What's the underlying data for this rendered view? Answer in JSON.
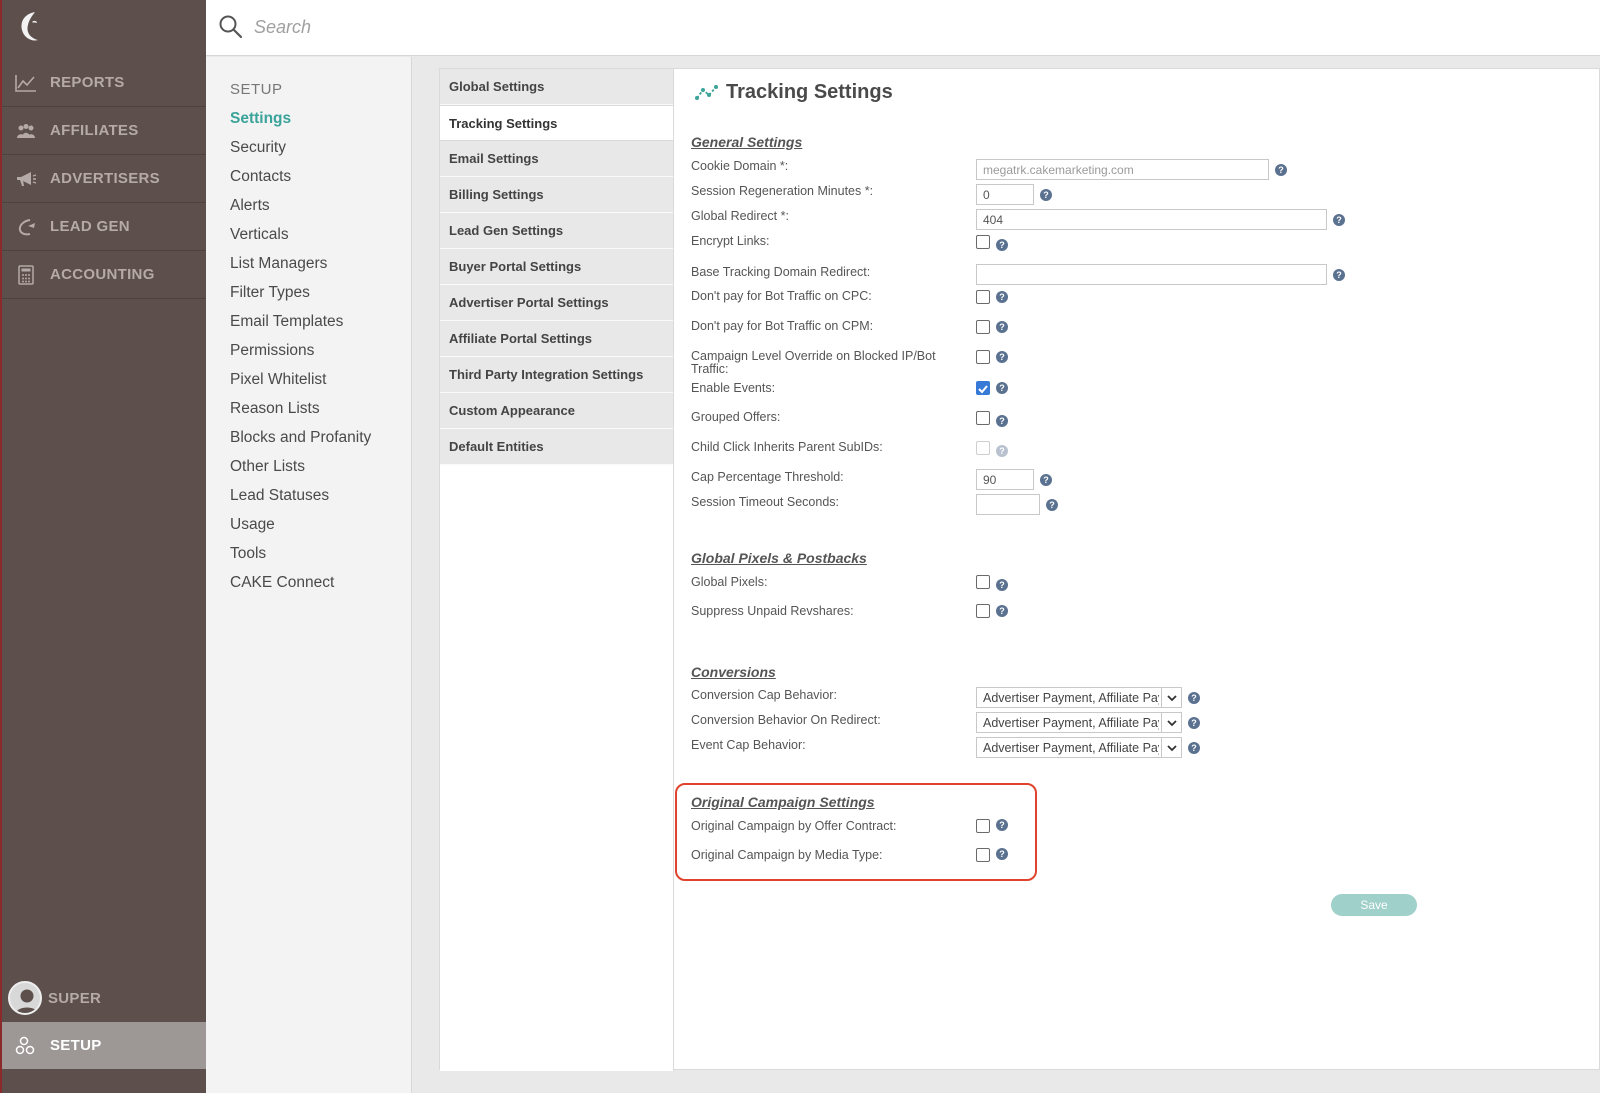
{
  "search": {
    "placeholder": "Search"
  },
  "nav": {
    "items": [
      {
        "label": "REPORTS"
      },
      {
        "label": "AFFILIATES"
      },
      {
        "label": "ADVERTISERS"
      },
      {
        "label": "LEAD GEN"
      },
      {
        "label": "ACCOUNTING"
      }
    ],
    "user_label": "SUPER",
    "setup_label": "SETUP"
  },
  "submenu": {
    "title": "SETUP",
    "items": [
      "Settings",
      "Security",
      "Contacts",
      "Alerts",
      "Verticals",
      "List Managers",
      "Filter Types",
      "Email Templates",
      "Permissions",
      "Pixel Whitelist",
      "Reason Lists",
      "Blocks and Profanity",
      "Other Lists",
      "Lead Statuses",
      "Usage",
      "Tools",
      "CAKE Connect"
    ]
  },
  "tabs": [
    "Global Settings",
    "Tracking Settings",
    "Email Settings",
    "Billing Settings",
    "Lead Gen Settings",
    "Buyer Portal Settings",
    "Advertiser Portal Settings",
    "Affiliate Portal Settings",
    "Third Party Integration Settings",
    "Custom Appearance",
    "Default Entities"
  ],
  "page": {
    "title": "Tracking Settings",
    "save_label": "Save"
  },
  "general": {
    "title": "General Settings",
    "cookie_domain": {
      "label": "Cookie Domain *:",
      "value": "megatrk.cakemarketing.com"
    },
    "session_regen": {
      "label": "Session Regeneration Minutes *:",
      "value": "0"
    },
    "global_redirect": {
      "label": "Global Redirect *:",
      "value": "404"
    },
    "encrypt_links": {
      "label": "Encrypt Links:",
      "checked": false
    },
    "base_tracking": {
      "label": "Base Tracking Domain Redirect:",
      "value": ""
    },
    "bot_cpc": {
      "label": "Don't pay for Bot Traffic on CPC:",
      "checked": false
    },
    "bot_cpm": {
      "label": "Don't pay for Bot Traffic on CPM:",
      "checked": false
    },
    "campaign_override": {
      "label_1": "Campaign Level Override on Blocked IP/Bot",
      "label_2": "Traffic:",
      "checked": false
    },
    "enable_events": {
      "label": "Enable Events:",
      "checked": true
    },
    "grouped_offers": {
      "label": "Grouped Offers:",
      "checked": false
    },
    "child_click": {
      "label": "Child Click Inherits Parent SubIDs:",
      "checked": false
    },
    "cap_threshold": {
      "label": "Cap Percentage Threshold:",
      "value": "90"
    },
    "session_timeout": {
      "label": "Session Timeout Seconds:",
      "value": ""
    }
  },
  "pixels": {
    "title": "Global Pixels & Postbacks",
    "global_pixels": {
      "label": "Global Pixels:",
      "checked": false
    },
    "suppress_unpaid": {
      "label": "Suppress Unpaid Revshares:",
      "checked": false
    }
  },
  "conversions": {
    "title": "Conversions",
    "cap_behavior": {
      "label": "Conversion Cap Behavior:",
      "value": "Advertiser Payment, Affiliate Payment"
    },
    "behavior_redirect": {
      "label": "Conversion Behavior On Redirect:",
      "value": "Advertiser Payment, Affiliate Payment"
    },
    "event_cap": {
      "label": "Event Cap Behavior:",
      "value": "Advertiser Payment, Affiliate Payment"
    }
  },
  "original": {
    "title": "Original Campaign Settings",
    "by_offer_contract": {
      "label": "Original Campaign by Offer Contract:",
      "checked": false
    },
    "by_media_type": {
      "label": "Original Campaign by Media Type:",
      "checked": false
    }
  },
  "colors": {
    "accent": "#3aa39a",
    "sidebar": "#5c4f4c",
    "highlight": "#e0442e",
    "save": "#9fd0ca"
  }
}
